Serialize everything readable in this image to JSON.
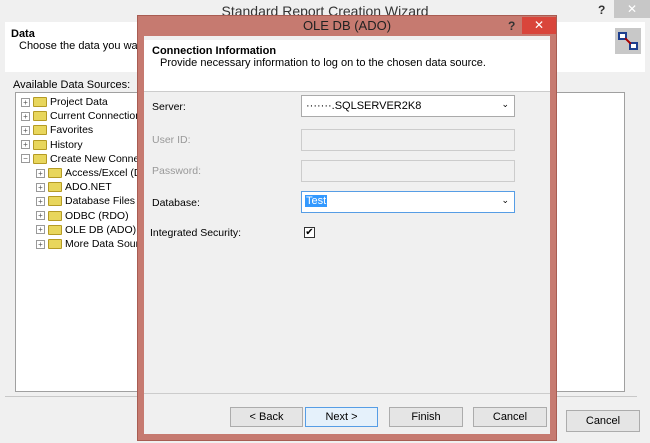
{
  "outer": {
    "title": "Standard Report Creation Wizard",
    "help": "?",
    "close": "✕",
    "section_title": "Data",
    "section_desc": "Choose the data you want to",
    "sources_label": "Available Data Sources:",
    "cancel": "Cancel",
    "tree": [
      {
        "label": "Project Data",
        "exp": "+",
        "level": 0
      },
      {
        "label": "Current Connections",
        "exp": "+",
        "level": 0
      },
      {
        "label": "Favorites",
        "exp": "+",
        "level": 0
      },
      {
        "label": "History",
        "exp": "+",
        "level": 0
      },
      {
        "label": "Create New Connection",
        "exp": "−",
        "level": 0
      },
      {
        "label": "Access/Excel (DAO)",
        "exp": "+",
        "level": 1
      },
      {
        "label": "ADO.NET",
        "exp": "+",
        "level": 1
      },
      {
        "label": "Database Files",
        "exp": "+",
        "level": 1
      },
      {
        "label": "ODBC (RDO)",
        "exp": "+",
        "level": 1
      },
      {
        "label": "OLE DB (ADO)",
        "exp": "+",
        "level": 1
      },
      {
        "label": "More Data Sources",
        "exp": "+",
        "level": 1
      }
    ]
  },
  "dialog": {
    "title": "OLE DB (ADO)",
    "help": "?",
    "close": "✕",
    "heading": "Connection Information",
    "subheading": "Provide necessary information to log on to the chosen data source.",
    "server_label": "Server:",
    "server_value": "·······.SQLSERVER2K8",
    "userid_label": "User ID:",
    "userid_value": "",
    "password_label": "Password:",
    "password_value": "",
    "database_label": "Database:",
    "database_value": "Test",
    "integrated_label": "Integrated Security:",
    "integrated_checked": true,
    "back": "< Back",
    "next": "Next >",
    "finish": "Finish",
    "cancel": "Cancel"
  }
}
